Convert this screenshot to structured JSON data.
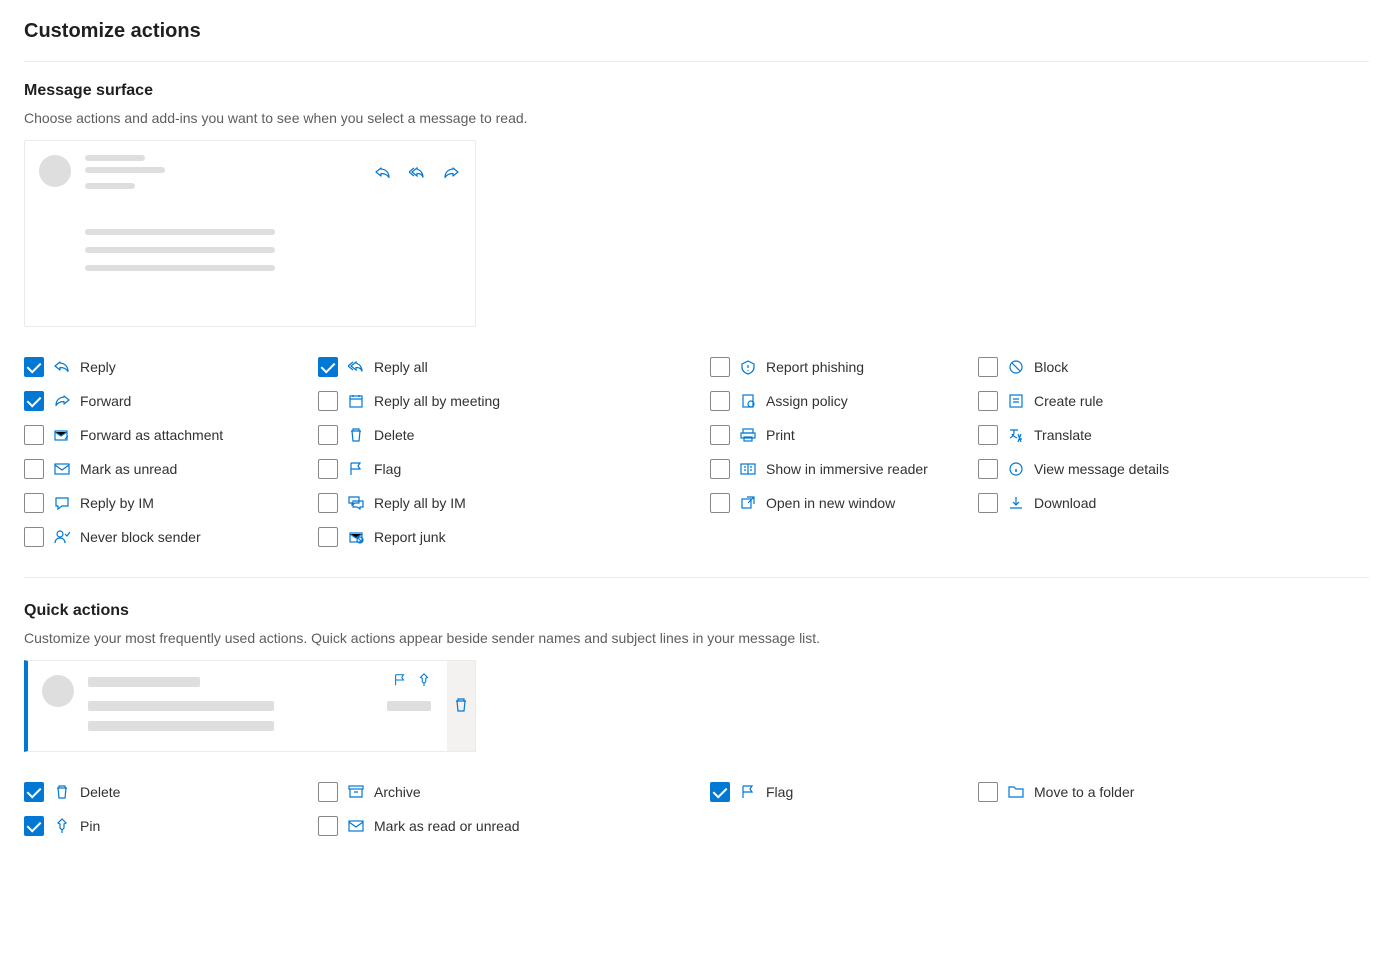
{
  "page_title": "Customize actions",
  "message_surface": {
    "title": "Message surface",
    "description": "Choose actions and add-ins you want to see when you select a message to read.",
    "options": [
      {
        "id": "reply",
        "label": "Reply",
        "checked": true,
        "icon": "reply"
      },
      {
        "id": "reply-all",
        "label": "Reply all",
        "checked": true,
        "icon": "reply-all"
      },
      {
        "id": "report-phishing",
        "label": "Report phishing",
        "checked": false,
        "icon": "phish"
      },
      {
        "id": "block",
        "label": "Block",
        "checked": false,
        "icon": "block"
      },
      {
        "id": "forward",
        "label": "Forward",
        "checked": true,
        "icon": "forward"
      },
      {
        "id": "reply-all-meeting",
        "label": "Reply all by meeting",
        "checked": false,
        "icon": "calendar"
      },
      {
        "id": "assign-policy",
        "label": "Assign policy",
        "checked": false,
        "icon": "policy"
      },
      {
        "id": "create-rule",
        "label": "Create rule",
        "checked": false,
        "icon": "rule"
      },
      {
        "id": "forward-attachment",
        "label": "Forward as attachment",
        "checked": false,
        "icon": "attach-mail"
      },
      {
        "id": "delete",
        "label": "Delete",
        "checked": false,
        "icon": "trash"
      },
      {
        "id": "print",
        "label": "Print",
        "checked": false,
        "icon": "print"
      },
      {
        "id": "translate",
        "label": "Translate",
        "checked": false,
        "icon": "translate"
      },
      {
        "id": "mark-unread",
        "label": "Mark as unread",
        "checked": false,
        "icon": "mail"
      },
      {
        "id": "flag",
        "label": "Flag",
        "checked": false,
        "icon": "flag"
      },
      {
        "id": "immersive",
        "label": "Show in immersive reader",
        "checked": false,
        "icon": "reader"
      },
      {
        "id": "view-details",
        "label": "View message details",
        "checked": false,
        "icon": "details"
      },
      {
        "id": "reply-im",
        "label": "Reply by IM",
        "checked": false,
        "icon": "im"
      },
      {
        "id": "reply-all-im",
        "label": "Reply all by IM",
        "checked": false,
        "icon": "im-all"
      },
      {
        "id": "open-window",
        "label": "Open in new window",
        "checked": false,
        "icon": "popout"
      },
      {
        "id": "download",
        "label": "Download",
        "checked": false,
        "icon": "download"
      },
      {
        "id": "never-block",
        "label": "Never block sender",
        "checked": false,
        "icon": "allow"
      },
      {
        "id": "report-junk",
        "label": "Report junk",
        "checked": false,
        "icon": "junk"
      }
    ]
  },
  "quick_actions": {
    "title": "Quick actions",
    "description": "Customize your most frequently used actions. Quick actions appear beside sender names and subject lines in your message list.",
    "options": [
      {
        "id": "qa-delete",
        "label": "Delete",
        "checked": true,
        "icon": "trash"
      },
      {
        "id": "qa-archive",
        "label": "Archive",
        "checked": false,
        "icon": "archive"
      },
      {
        "id": "qa-flag",
        "label": "Flag",
        "checked": true,
        "icon": "flag"
      },
      {
        "id": "qa-move",
        "label": "Move to a folder",
        "checked": false,
        "icon": "folder"
      },
      {
        "id": "qa-pin",
        "label": "Pin",
        "checked": true,
        "icon": "pin"
      },
      {
        "id": "qa-read",
        "label": "Mark as read or unread",
        "checked": false,
        "icon": "mail"
      }
    ]
  }
}
